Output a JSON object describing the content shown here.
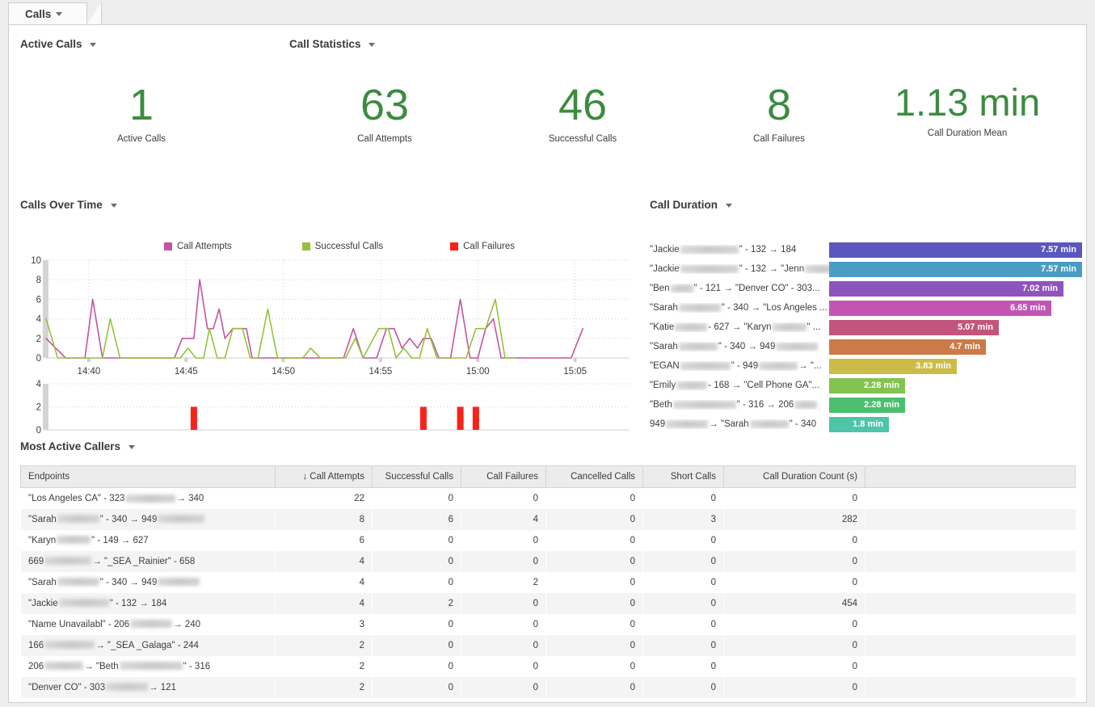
{
  "tab": {
    "label": "Calls"
  },
  "panels": {
    "active_calls": "Active Calls",
    "call_statistics": "Call Statistics",
    "calls_over_time": "Calls Over Time",
    "call_duration": "Call Duration",
    "most_active_callers": "Most Active Callers"
  },
  "kpis": [
    {
      "value": "1",
      "label": "Active Calls"
    },
    {
      "value": "63",
      "label": "Call Attempts"
    },
    {
      "value": "46",
      "label": "Successful Calls"
    },
    {
      "value": "8",
      "label": "Call Failures"
    },
    {
      "value": "1.13 min",
      "label": "Call Duration Mean"
    }
  ],
  "colors": {
    "kpi_green": "#3c8c40",
    "call_attempts": "#c6539f",
    "successful_calls": "#95c13d",
    "call_failures": "#fa2119"
  },
  "chart_data": [
    {
      "type": "line",
      "title": "Calls Over Time",
      "xlabel": "",
      "ylabel": "",
      "ylim": [
        0,
        10
      ],
      "yticks": [
        0,
        2,
        4,
        6,
        8,
        10
      ],
      "xticks": [
        "14:40",
        "14:45",
        "14:50",
        "14:55",
        "15:00",
        "15:05"
      ],
      "grid": true,
      "legend": [
        "Call Attempts",
        "Successful Calls",
        "Call Failures"
      ],
      "legend_position": "top",
      "series": [
        {
          "name": "Call Attempts",
          "color": "#c6539f",
          "points": [
            [
              0.0,
              2
            ],
            [
              1.0,
              0
            ],
            [
              2.0,
              0
            ],
            [
              2.4,
              6
            ],
            [
              2.9,
              0
            ],
            [
              3.4,
              0
            ],
            [
              3.9,
              0
            ],
            [
              4.4,
              0
            ],
            [
              6.6,
              0
            ],
            [
              7.0,
              2
            ],
            [
              7.4,
              2
            ],
            [
              7.6,
              2
            ],
            [
              7.9,
              8
            ],
            [
              8.3,
              3
            ],
            [
              8.6,
              3
            ],
            [
              8.9,
              5
            ],
            [
              9.2,
              2
            ],
            [
              9.6,
              3
            ],
            [
              10.0,
              3
            ],
            [
              10.3,
              3
            ],
            [
              10.6,
              0
            ],
            [
              11.1,
              0
            ],
            [
              11.5,
              0
            ],
            [
              14.2,
              0
            ],
            [
              15.3,
              0
            ],
            [
              15.8,
              3
            ],
            [
              16.3,
              0
            ],
            [
              17.0,
              0
            ],
            [
              17.5,
              3
            ],
            [
              17.9,
              3
            ],
            [
              18.3,
              1
            ],
            [
              18.7,
              2
            ],
            [
              19.1,
              1
            ],
            [
              19.4,
              2
            ],
            [
              19.8,
              2
            ],
            [
              20.2,
              0
            ],
            [
              20.8,
              0
            ],
            [
              21.3,
              6
            ],
            [
              21.8,
              0
            ],
            [
              22.2,
              0
            ],
            [
              22.6,
              3
            ],
            [
              23.0,
              4
            ],
            [
              23.4,
              0
            ],
            [
              24.0,
              0
            ],
            [
              27.0,
              0
            ],
            [
              27.6,
              3
            ]
          ]
        },
        {
          "name": "Successful Calls",
          "color": "#95c13d",
          "points": [
            [
              0.0,
              4
            ],
            [
              0.6,
              0
            ],
            [
              1.6,
              0
            ],
            [
              2.1,
              0
            ],
            [
              2.9,
              0
            ],
            [
              3.3,
              4
            ],
            [
              3.8,
              0
            ],
            [
              4.4,
              0
            ],
            [
              6.9,
              0
            ],
            [
              7.3,
              1
            ],
            [
              7.7,
              0
            ],
            [
              8.1,
              0
            ],
            [
              8.4,
              3
            ],
            [
              8.8,
              0
            ],
            [
              9.2,
              0
            ],
            [
              9.6,
              3
            ],
            [
              10.1,
              3
            ],
            [
              10.5,
              0
            ],
            [
              10.9,
              0
            ],
            [
              11.4,
              5
            ],
            [
              11.9,
              0
            ],
            [
              13.2,
              0
            ],
            [
              13.6,
              1
            ],
            [
              14.1,
              0
            ],
            [
              15.4,
              0
            ],
            [
              15.9,
              2
            ],
            [
              16.3,
              0
            ],
            [
              17.1,
              3
            ],
            [
              17.6,
              3
            ],
            [
              18.0,
              0
            ],
            [
              18.4,
              1
            ],
            [
              18.8,
              0
            ],
            [
              19.2,
              0
            ],
            [
              19.6,
              3
            ],
            [
              20.1,
              0
            ],
            [
              21.0,
              0
            ],
            [
              21.6,
              0
            ],
            [
              22.1,
              3
            ],
            [
              22.6,
              3
            ],
            [
              23.1,
              6
            ],
            [
              23.6,
              0
            ],
            [
              24.1,
              0
            ]
          ]
        }
      ]
    },
    {
      "type": "bar",
      "title": "Call Failures Over Time",
      "ylim": [
        0,
        4
      ],
      "yticks": [
        0,
        2,
        4
      ],
      "grid": true,
      "color": "#fa2119",
      "series_name": "Call Failures",
      "bars": [
        {
          "x": 7.6,
          "value": 2
        },
        {
          "x": 19.4,
          "value": 2
        },
        {
          "x": 21.3,
          "value": 2
        },
        {
          "x": 22.1,
          "value": 2
        }
      ]
    },
    {
      "type": "bar",
      "orientation": "horizontal",
      "title": "Call Duration",
      "unit": "min",
      "xlim": [
        0,
        8
      ],
      "categories": [
        "\"Jackie ▒▒▒▒\" - 132 → 184",
        "\"Jackie ▒▒▒▒\" - 132 → \"Jenn▒▒▒▒",
        "\"Ben ▒▒\" - 121 → \"Denver CO\" - 303...",
        "\"Sarah ▒▒▒▒\" - 340 → \"Los Angeles ...",
        "\"Katie ▒▒▒ - 627 → \"Karyn ▒▒▒▒\" ...",
        "\"Sarah ▒▒▒▒\" - 340 → 949 ▒▒▒▒",
        "\"EGAN▒▒▒▒\" - 949 ▒▒▒▒ → \"...",
        "\"Emily ▒▒▒ - 168 → \"Cell Phone GA\"...",
        "\"Beth ▒▒▒▒▒\" - 316 → 206▒▒▒",
        "949 ▒▒▒▒ → \"Sarah ▒▒▒▒\" - 340"
      ],
      "values": [
        7.57,
        7.57,
        7.02,
        6.65,
        5.07,
        4.7,
        3.83,
        2.28,
        2.28,
        1.8
      ],
      "value_labels": [
        "7.57 min",
        "7.57 min",
        "7.02 min",
        "6.65 min",
        "5.07 min",
        "4.7 min",
        "3.83 min",
        "2.28 min",
        "2.28 min",
        "1.8 min"
      ],
      "colors": [
        "#5b57bf",
        "#4b9cc2",
        "#8e54bd",
        "#c255b4",
        "#c2557b",
        "#cc7a4a",
        "#cbbc4a",
        "#83c352",
        "#4cbf6e",
        "#4ec4a8"
      ]
    }
  ],
  "duration_rows": [
    {
      "parts": [
        {
          "t": "\"Jackie"
        },
        {
          "b": 72
        },
        {
          "t": "\" - 132 → 184"
        }
      ],
      "label_plain": "\"Jackie\" - 132 → 184",
      "value_label": "7.57 min",
      "value": 7.57,
      "color": "#5b57bf"
    },
    {
      "parts": [
        {
          "t": "\"Jackie"
        },
        {
          "b": 72
        },
        {
          "t": "\" - 132 → \"Jenn"
        },
        {
          "b": 42
        }
      ],
      "label_plain": "\"Jackie\" - 132 → \"Jenn",
      "value_label": "7.57 min",
      "value": 7.57,
      "color": "#4b9cc2"
    },
    {
      "parts": [
        {
          "t": "\"Ben"
        },
        {
          "b": 28
        },
        {
          "t": "\" - 121 → \"Denver CO\" - 303..."
        }
      ],
      "label_plain": "\"Ben\" - 121 → \"Denver CO\" - 303...",
      "value_label": "7.02 min",
      "value": 7.02,
      "color": "#8e54bd"
    },
    {
      "parts": [
        {
          "t": "\"Sarah"
        },
        {
          "b": 52
        },
        {
          "t": "\" - 340 → \"Los Angeles ..."
        }
      ],
      "label_plain": "\"Sarah\" - 340 → \"Los Angeles ...",
      "value_label": "6.65 min",
      "value": 6.65,
      "color": "#c255b4"
    },
    {
      "parts": [
        {
          "t": "\"Katie"
        },
        {
          "b": 40
        },
        {
          "t": "- 627 → \"Karyn"
        },
        {
          "b": 42
        },
        {
          "t": "\" ..."
        }
      ],
      "label_plain": "\"Katie - 627 → \"Karyn\" ...",
      "value_label": "5.07 min",
      "value": 5.07,
      "color": "#c2557b"
    },
    {
      "parts": [
        {
          "t": "\"Sarah"
        },
        {
          "b": 48
        },
        {
          "t": "\" - 340 → 949"
        },
        {
          "b": 52
        }
      ],
      "label_plain": "\"Sarah\" - 340 → 949",
      "value_label": "4.7 min",
      "value": 4.7,
      "color": "#cc7a4a"
    },
    {
      "parts": [
        {
          "t": "\"EGAN"
        },
        {
          "b": 62
        },
        {
          "t": "\" - 949"
        },
        {
          "b": 48
        },
        {
          "t": "→ \"..."
        }
      ],
      "label_plain": "\"EGAN\" - 949 → \"...",
      "value_label": "3.83 min",
      "value": 3.83,
      "color": "#cbbc4a"
    },
    {
      "parts": [
        {
          "t": "\"Emily"
        },
        {
          "b": 38
        },
        {
          "t": "- 168 → \"Cell Phone GA\"..."
        }
      ],
      "label_plain": "\"Emily - 168 → \"Cell Phone GA\"...",
      "value_label": "2.28 min",
      "value": 2.28,
      "color": "#83c352"
    },
    {
      "parts": [
        {
          "t": "\"Beth"
        },
        {
          "b": 78
        },
        {
          "t": "\" - 316 → 206"
        },
        {
          "b": 28
        }
      ],
      "label_plain": "\"Beth\" - 316 → 206",
      "value_label": "2.28 min",
      "value": 2.28,
      "color": "#4cbf6e"
    },
    {
      "parts": [
        {
          "t": "949"
        },
        {
          "b": 52
        },
        {
          "t": "→ \"Sarah"
        },
        {
          "b": 48
        },
        {
          "t": "\" - 340"
        }
      ],
      "label_plain": "949 → \"Sarah\" - 340",
      "value_label": "1.8 min",
      "value": 1.8,
      "color": "#4ec4a8"
    }
  ],
  "table": {
    "sort_indicator": "↓",
    "sorted_column": "Call Attempts",
    "columns": [
      "Endpoints",
      "Call Attempts",
      "Successful Calls",
      "Call Failures",
      "Cancelled Calls",
      "Short Calls",
      "Call Duration Count (s)",
      ""
    ],
    "rows": [
      {
        "parts": [
          {
            "t": "\"Los Angeles CA\" - 323"
          },
          {
            "b": 62
          },
          {
            "t": "→ 340"
          }
        ],
        "endpoint_plain": "\"Los Angeles CA\" - 323 → 340",
        "attempts": "22",
        "successful": "0",
        "failures": "0",
        "cancelled": "0",
        "short": "0",
        "duration_count": "0"
      },
      {
        "parts": [
          {
            "t": "\"Sarah"
          },
          {
            "b": 52
          },
          {
            "t": "\" - 340 → 949"
          },
          {
            "b": 58
          }
        ],
        "endpoint_plain": "\"Sarah\" - 340 → 949",
        "attempts": "8",
        "successful": "6",
        "failures": "4",
        "cancelled": "0",
        "short": "3",
        "duration_count": "282"
      },
      {
        "parts": [
          {
            "t": "\"Karyn"
          },
          {
            "b": 42
          },
          {
            "t": "\" - 149 → 627"
          }
        ],
        "endpoint_plain": "\"Karyn\" - 149 → 627",
        "attempts": "6",
        "successful": "0",
        "failures": "0",
        "cancelled": "0",
        "short": "0",
        "duration_count": "0"
      },
      {
        "parts": [
          {
            "t": "669"
          },
          {
            "b": 58
          },
          {
            "t": "→ \"_SEA _Rainier\" - 658"
          }
        ],
        "endpoint_plain": "669 → \"_SEA _Rainier\" - 658",
        "attempts": "4",
        "successful": "0",
        "failures": "0",
        "cancelled": "0",
        "short": "0",
        "duration_count": "0"
      },
      {
        "parts": [
          {
            "t": "\"Sarah"
          },
          {
            "b": 52
          },
          {
            "t": "\" - 340 → 949"
          },
          {
            "b": 52
          }
        ],
        "endpoint_plain": "\"Sarah\" - 340 → 949",
        "attempts": "4",
        "successful": "0",
        "failures": "2",
        "cancelled": "0",
        "short": "0",
        "duration_count": "0"
      },
      {
        "parts": [
          {
            "t": "\"Jackie"
          },
          {
            "b": 62
          },
          {
            "t": "\" - 132 → 184"
          }
        ],
        "endpoint_plain": "\"Jackie\" - 132 → 184",
        "attempts": "4",
        "successful": "2",
        "failures": "0",
        "cancelled": "0",
        "short": "0",
        "duration_count": "454"
      },
      {
        "parts": [
          {
            "t": "\"Name Unavailabl\" - 206"
          },
          {
            "b": 52
          },
          {
            "t": "→ 240"
          }
        ],
        "endpoint_plain": "\"Name Unavailabl\" - 206 → 240",
        "attempts": "3",
        "successful": "0",
        "failures": "0",
        "cancelled": "0",
        "short": "0",
        "duration_count": "0"
      },
      {
        "parts": [
          {
            "t": "166"
          },
          {
            "b": 62
          },
          {
            "t": "→ \"_SEA _Galaga\" - 244"
          }
        ],
        "endpoint_plain": "166 → \"_SEA _Galaga\" - 244",
        "attempts": "2",
        "successful": "0",
        "failures": "0",
        "cancelled": "0",
        "short": "0",
        "duration_count": "0"
      },
      {
        "parts": [
          {
            "t": "206"
          },
          {
            "b": 48
          },
          {
            "t": "→ \"Beth"
          },
          {
            "b": 78
          },
          {
            "t": "\" - 316"
          }
        ],
        "endpoint_plain": "206 → \"Beth\" - 316",
        "attempts": "2",
        "successful": "0",
        "failures": "0",
        "cancelled": "0",
        "short": "0",
        "duration_count": "0"
      },
      {
        "parts": [
          {
            "t": "\"Denver CO\" - 303"
          },
          {
            "b": 52
          },
          {
            "t": "→ 121"
          }
        ],
        "endpoint_plain": "\"Denver CO\" - 303 → 121",
        "attempts": "2",
        "successful": "0",
        "failures": "0",
        "cancelled": "0",
        "short": "0",
        "duration_count": "0"
      }
    ]
  }
}
